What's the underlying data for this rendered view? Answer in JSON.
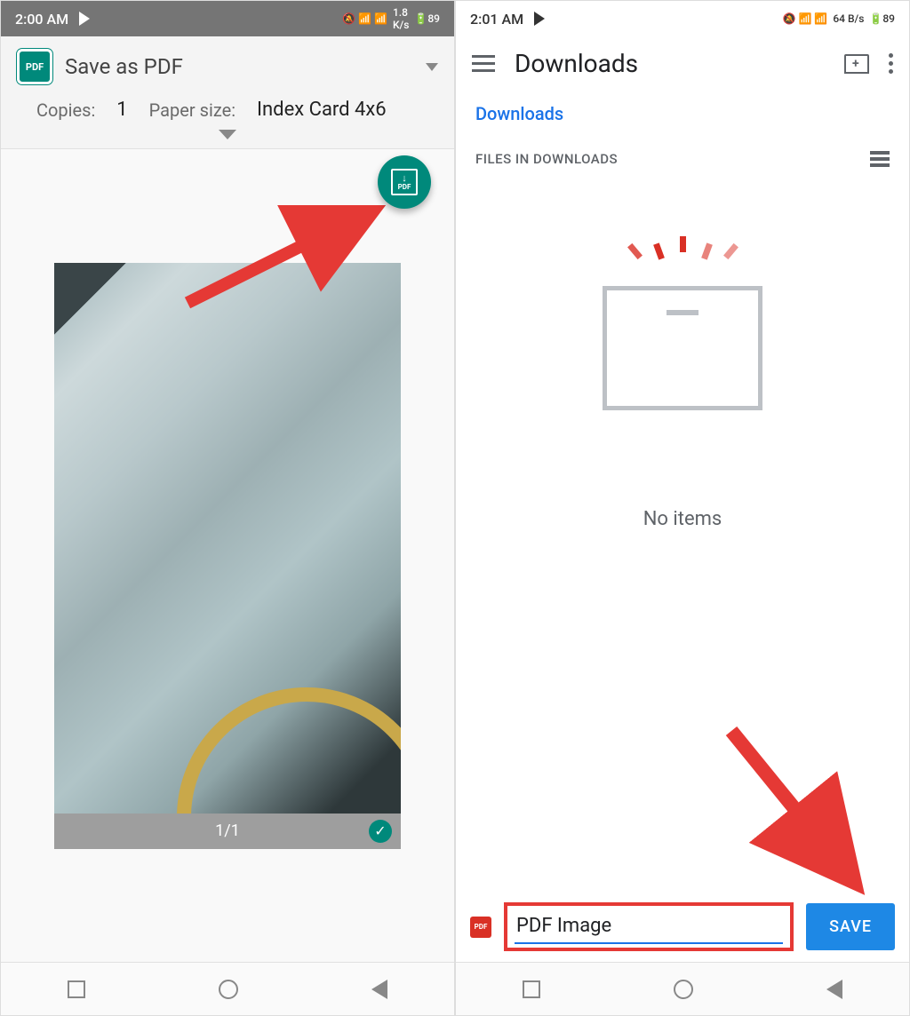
{
  "left": {
    "status": {
      "time": "2:00 AM",
      "battery": "89"
    },
    "printer": {
      "destination": "Save as PDF",
      "copies_label": "Copies:",
      "copies_value": "1",
      "paper_label": "Paper size:",
      "paper_value": "Index Card 4x6"
    },
    "page_counter": "1/1"
  },
  "right": {
    "status": {
      "time": "2:01 AM",
      "battery": "89",
      "net": "64 B/s"
    },
    "title": "Downloads",
    "breadcrumb": "Downloads",
    "section_header": "FILES IN DOWNLOADS",
    "empty_text": "No items",
    "filename": "PDF Image",
    "save_label": "SAVE"
  }
}
